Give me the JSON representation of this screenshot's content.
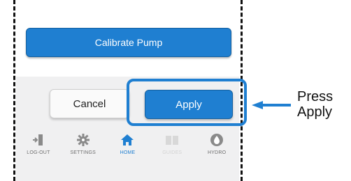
{
  "calibrate_button": "Calibrate Pump",
  "dialog": {
    "cancel_label": "Cancel",
    "apply_label": "Apply"
  },
  "nav": [
    {
      "label": "LOG-OUT",
      "icon": "logout-icon",
      "state": "normal"
    },
    {
      "label": "SETTINGS",
      "icon": "gear-icon",
      "state": "normal"
    },
    {
      "label": "HOME",
      "icon": "home-icon",
      "state": "active"
    },
    {
      "label": "GUIDES",
      "icon": "book-icon",
      "state": "disabled"
    },
    {
      "label": "HYDRO",
      "icon": "hydro-icon",
      "state": "normal"
    }
  ],
  "annotation": {
    "line1": "Press",
    "line2": "Apply"
  },
  "colors": {
    "accent": "#1f7fd1",
    "panel": "#f0f0f1",
    "icon_gray": "#8a8a8a",
    "disabled": "#d3d3d3"
  }
}
